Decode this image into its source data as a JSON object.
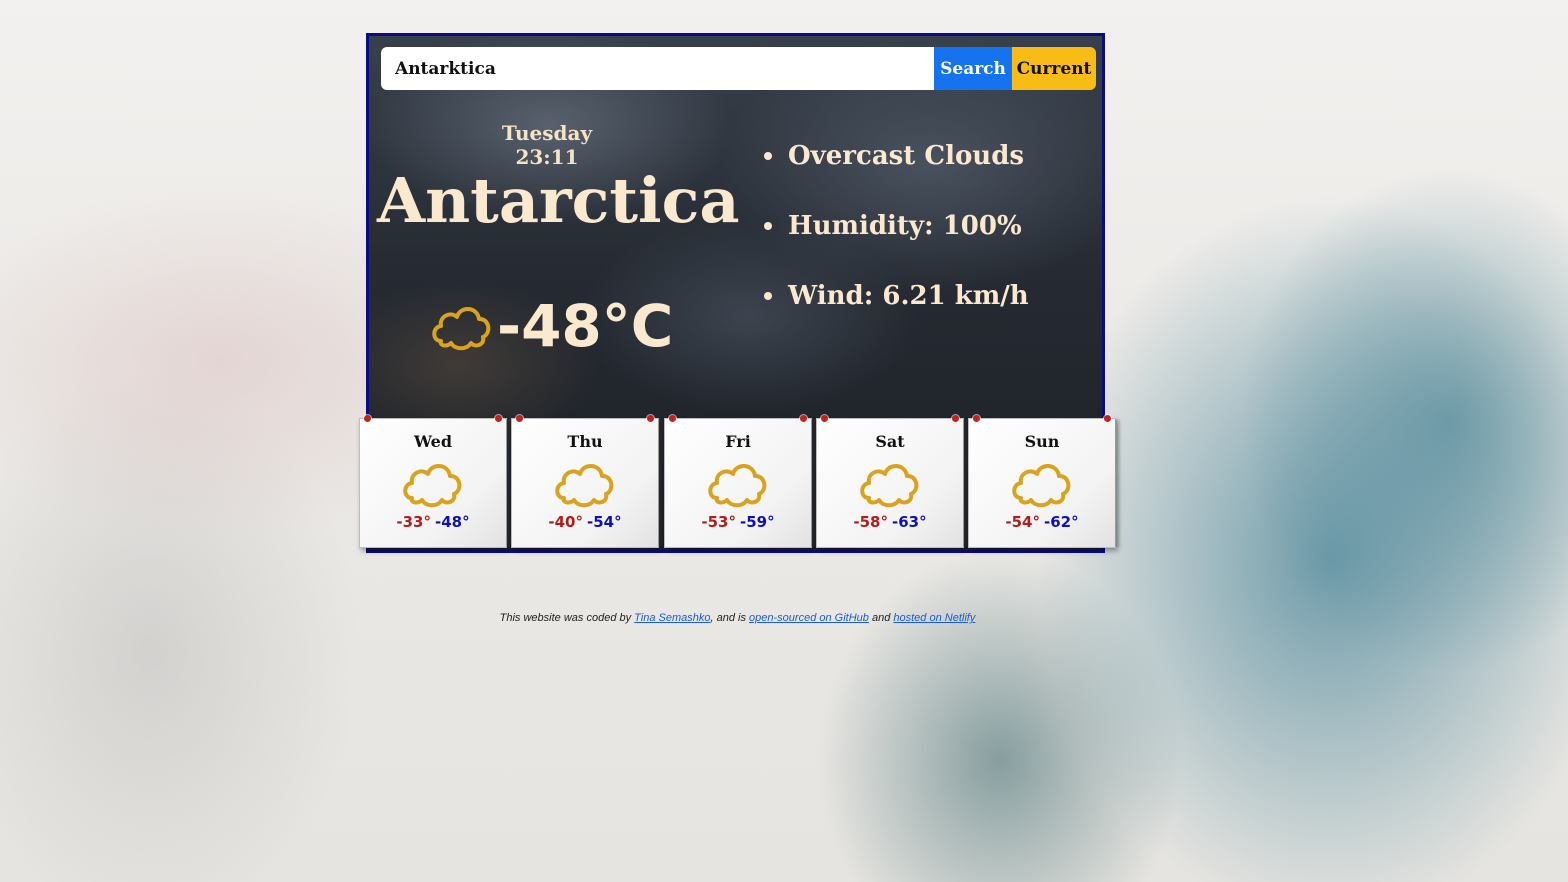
{
  "search": {
    "value": "Antarktica",
    "search_label": "Search",
    "current_label": "Current"
  },
  "current": {
    "datetime": "Tuesday 23:11",
    "city": "Antarctica",
    "temperature": "-48°C",
    "icon": "cloud-icon",
    "description": "Overcast Clouds",
    "humidity": "Humidity: 100%",
    "wind": "Wind: 6.21 km/h"
  },
  "forecast": [
    {
      "day": "Wed",
      "high": "-33°",
      "low": "-48°",
      "icon": "cloud-icon"
    },
    {
      "day": "Thu",
      "high": "-40°",
      "low": "-54°",
      "icon": "cloud-icon"
    },
    {
      "day": "Fri",
      "high": "-53°",
      "low": "-59°",
      "icon": "cloud-icon"
    },
    {
      "day": "Sat",
      "high": "-58°",
      "low": "-63°",
      "icon": "cloud-icon"
    },
    {
      "day": "Sun",
      "high": "-54°",
      "low": "-62°",
      "icon": "cloud-icon"
    }
  ],
  "footer": {
    "prefix": "This website was coded by",
    "author_link": "Tina Semashko",
    "middle": ", and is",
    "github_link": "open-sourced on GitHub",
    "and": "and",
    "netlify_link": "hosted on Netlify"
  },
  "colors": {
    "search_button": "#1673f0",
    "current_button": "#f7bd16",
    "card_border": "#0b0b86",
    "high_temp": "#b11d1d",
    "low_temp": "#1010b4",
    "icon_gold": "#d9a21f"
  }
}
